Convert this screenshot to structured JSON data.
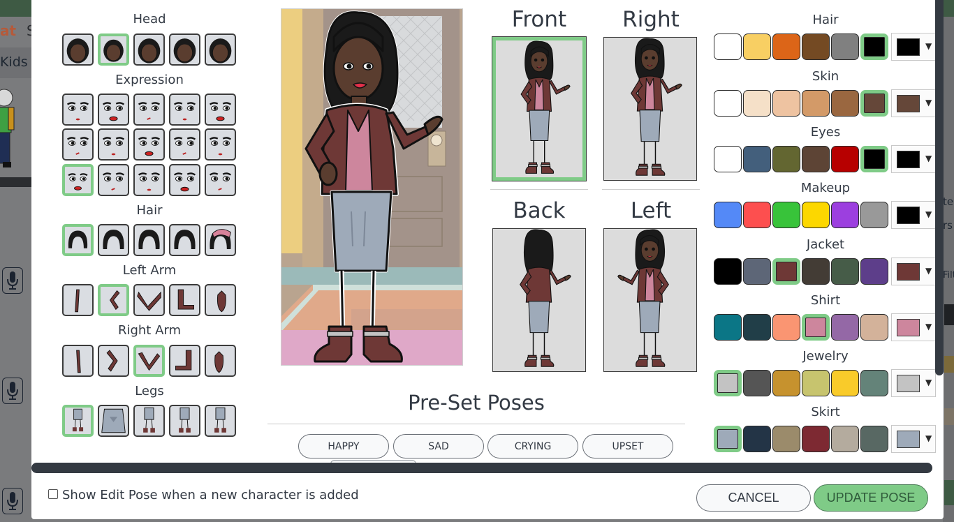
{
  "background_app": {
    "brand_fragment": "at",
    "brand_fragment_2": "S",
    "nav_item": "Kids",
    "right_text_1": "te",
    "right_text_2": "rs",
    "right_text_3": "Filt"
  },
  "pose_parts": {
    "head": {
      "title": "Head",
      "options": 5,
      "selected": 1
    },
    "expression": {
      "title": "Expression",
      "options": 15,
      "selected": 10
    },
    "hair": {
      "title": "Hair",
      "options": 5,
      "selected": 0
    },
    "left_arm": {
      "title": "Left Arm",
      "options": 5,
      "selected": 1
    },
    "right_arm": {
      "title": "Right Arm",
      "options": 5,
      "selected": 2
    },
    "legs": {
      "title": "Legs",
      "options": 5,
      "selected": 0
    }
  },
  "views": {
    "front": "Front",
    "right": "Right",
    "back": "Back",
    "left": "Left",
    "selected": "front"
  },
  "preset_poses": {
    "title": "Pre-Set Poses",
    "buttons": [
      "HAPPY",
      "SAD",
      "CRYING",
      "UPSET"
    ]
  },
  "colors": [
    {
      "title": "Hair",
      "swatches": [
        "#ffffff",
        "#f8cf63",
        "#dc6518",
        "#744a23",
        "#808080",
        "#000000"
      ],
      "selected": 5,
      "current": "#000000"
    },
    {
      "title": "Skin",
      "swatches": [
        "#ffffff",
        "#f5e0c8",
        "#eec3a1",
        "#d39a68",
        "#9a6740",
        "#654739"
      ],
      "selected": 5,
      "current": "#654739"
    },
    {
      "title": "Eyes",
      "swatches": [
        "#ffffff",
        "#435f7c",
        "#636631",
        "#5d4435",
        "#b70000",
        "#000000"
      ],
      "selected": 5,
      "current": "#000000"
    },
    {
      "title": "Makeup",
      "swatches": [
        "#5489f7",
        "#fd4f4f",
        "#38c33a",
        "#fcd700",
        "#9c3fdf",
        "#999999"
      ],
      "selected": -1,
      "current": "#000000"
    },
    {
      "title": "Jacket",
      "swatches": [
        "#000000",
        "#5d6677",
        "#6e3836",
        "#433c35",
        "#465c48",
        "#5d3e8a"
      ],
      "selected": 2,
      "current": "#6e3836"
    },
    {
      "title": "Shirt",
      "swatches": [
        "#0b7686",
        "#213e48",
        "#fa9572",
        "#cd869d",
        "#9468a6",
        "#d3b29a"
      ],
      "selected": 3,
      "current": "#cd869d"
    },
    {
      "title": "Jewelry",
      "swatches": [
        "#c3c3c3",
        "#555555",
        "#c6922e",
        "#c7c46e",
        "#f9cb2a",
        "#648379"
      ],
      "selected": 0,
      "current": "#c3c3c3"
    },
    {
      "title": "Skirt",
      "swatches": [
        "#9eaab9",
        "#233446",
        "#9b8b6b",
        "#7d2932",
        "#b4ab9e",
        "#586863"
      ],
      "selected": 0,
      "current": "#9eaab9"
    }
  ],
  "footer": {
    "checkbox_label": "Show Edit Pose when a new character is added",
    "checkbox_checked": false,
    "cancel_label": "CANCEL",
    "update_label": "UPDATE POSE"
  }
}
